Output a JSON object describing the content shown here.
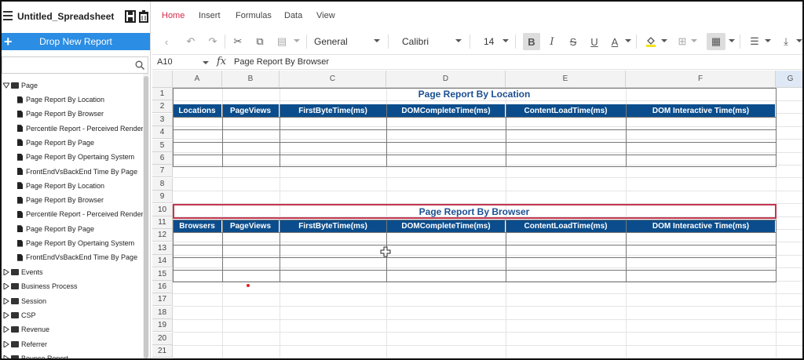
{
  "app": {
    "title": "Untitled_Spreadsheet",
    "save_icon": "save-icon",
    "delete_icon": "trash-icon"
  },
  "sidebar": {
    "drop_button": "Drop New Report",
    "search_placeholder": "",
    "tree": {
      "root": "Page",
      "children": [
        "Page Report By Location",
        "Page Report By Browser",
        "Percentile Report - Perceived Render",
        "Page Report By Page",
        "Page Report By Opertaing System",
        "FrontEndVsBackEnd Time By Page",
        "Page Report By Location",
        "Page Report By Browser",
        "Percentile Report - Perceived Render",
        "Page Report By Page",
        "Page Report By Opertaing System",
        "FrontEndVsBackEnd Time By Page"
      ],
      "folders": [
        "Events",
        "Business Process",
        "Session",
        "CSP",
        "Revenue",
        "Referrer",
        "Bounce Report"
      ]
    }
  },
  "menu": {
    "items": [
      "Home",
      "Insert",
      "Formulas",
      "Data",
      "View"
    ],
    "active": "Home"
  },
  "toolbar": {
    "number_format": "General",
    "font_family": "Calibri",
    "font_size": "14"
  },
  "formula_bar": {
    "cell_ref": "A10",
    "fx": "fx",
    "content": "Page Report By Browser"
  },
  "grid": {
    "columns": [
      "A",
      "B",
      "C",
      "D",
      "E",
      "F",
      "G"
    ],
    "rows": [
      "1",
      "2",
      "3",
      "4",
      "5",
      "6",
      "7",
      "8",
      "9",
      "10",
      "11",
      "12",
      "13",
      "14",
      "15",
      "16",
      "17",
      "18",
      "19",
      "20",
      "21"
    ],
    "table1": {
      "title": "Page Report By Location",
      "headers": [
        "Locations",
        "PageViews",
        "FirstByteTime(ms)",
        "DOMCompleteTime(ms)",
        "ContentLoadTime(ms)",
        "DOM Interactive Time(ms)"
      ]
    },
    "table2": {
      "title": "Page Report By Browser",
      "headers": [
        "Browsers",
        "PageViews",
        "FirstByteTime(ms)",
        "DOMCompleteTime(ms)",
        "ContentLoadTime(ms)",
        "DOM Interactive Time(ms)"
      ]
    }
  },
  "colors": {
    "accent": "#d0294a",
    "header_blue": "#0b4d8c",
    "title_blue": "#1b4f92",
    "button_blue": "#2b8de3"
  }
}
